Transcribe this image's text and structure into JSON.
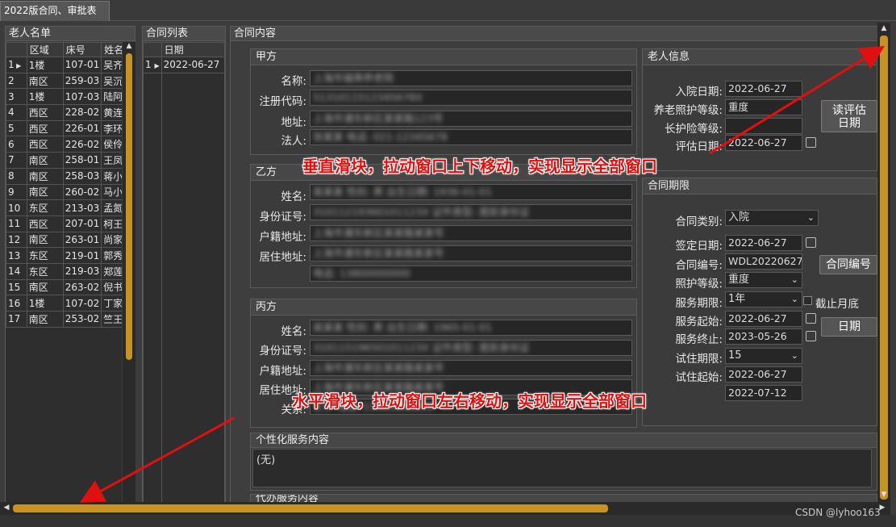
{
  "window": {
    "tab_label": "2022版合同、审批表"
  },
  "elders": {
    "title": "老人名单",
    "columns": [
      "区域",
      "床号",
      "姓名"
    ],
    "rows": [
      {
        "n": "1",
        "area": "1楼",
        "bed": "107-01",
        "name": "吴齐"
      },
      {
        "n": "2",
        "area": "南区",
        "bed": "259-03",
        "name": "吴沉"
      },
      {
        "n": "3",
        "area": "1楼",
        "bed": "107-03",
        "name": "陆阿"
      },
      {
        "n": "4",
        "area": "西区",
        "bed": "228-02",
        "name": "黄连"
      },
      {
        "n": "5",
        "area": "西区",
        "bed": "226-01",
        "name": "李环"
      },
      {
        "n": "6",
        "area": "西区",
        "bed": "226-02",
        "name": "侯伶"
      },
      {
        "n": "7",
        "area": "南区",
        "bed": "258-01",
        "name": "王凤"
      },
      {
        "n": "8",
        "area": "南区",
        "bed": "258-03",
        "name": "蒋小"
      },
      {
        "n": "9",
        "area": "南区",
        "bed": "260-02",
        "name": "马小"
      },
      {
        "n": "10",
        "area": "东区",
        "bed": "213-03",
        "name": "孟氮"
      },
      {
        "n": "11",
        "area": "西区",
        "bed": "207-01",
        "name": "柯王"
      },
      {
        "n": "12",
        "area": "南区",
        "bed": "263-01",
        "name": "尚家"
      },
      {
        "n": "13",
        "area": "东区",
        "bed": "219-01",
        "name": "郭秀"
      },
      {
        "n": "14",
        "area": "东区",
        "bed": "219-03",
        "name": "郑莲"
      },
      {
        "n": "15",
        "area": "南区",
        "bed": "263-02",
        "name": "倪书"
      },
      {
        "n": "16",
        "area": "1楼",
        "bed": "107-02",
        "name": "丁家"
      },
      {
        "n": "17",
        "area": "南区",
        "bed": "253-02",
        "name": "竺王"
      }
    ]
  },
  "contracts": {
    "title": "合同列表",
    "column": "日期",
    "rows": [
      {
        "n": "1",
        "date": "2022-06-27"
      }
    ]
  },
  "content": {
    "title": "合同内容",
    "party_a": {
      "title": "甲方",
      "name_label": "名称:",
      "code_label": "注册代码:",
      "address_label": "地址:",
      "legal_label": "法人:",
      "name_value": "上海市福寿养老院",
      "code_value": "5131011512345678X",
      "address_value": "上海市浦东新区某某路123号",
      "legal_value": "张某某  电话: 021-12345678"
    },
    "party_b": {
      "title": "乙方",
      "name_label": "姓名:",
      "id_label": "身份证号:",
      "hukou_label": "户籍地址:",
      "residence_label": "居住地址:",
      "name_value": "吴某某   性别: 男   出生日期: 1936-01-01",
      "id_value": "31011219360101123X   证件类型: 居民身份证",
      "hukou_value": "上海市浦东新区某某路某某号",
      "residence_value": "上海市浦东新区某某路某某号",
      "phone_value": "电话: 13800000000"
    },
    "party_c": {
      "title": "丙方",
      "name_label": "姓名:",
      "id_label": "身份证号:",
      "hukou_label": "户籍地址:",
      "residence_label": "居住地址:",
      "relation_label": "关系:",
      "name_value": "吴某某   性别: 男   出生日期: 1965-01-01",
      "id_value": "31011519650101123X   证件类型: 居民身份证",
      "hukou_value": "上海市浦东新区某某路某某号",
      "residence_value": "上海市浦东新区某某路某某号",
      "relation_value": "父子   电话: 13900000000"
    },
    "elder_info": {
      "title": "老人信息",
      "admit_label": "入院日期:",
      "admit_value": "2022-06-27",
      "care_label": "养老照护等级:",
      "care_value": "重度",
      "ltc_label": "长护险等级:",
      "ltc_value": "",
      "eval_label": "评估日期:",
      "eval_value": "2022-06-27",
      "read_btn": "读评估\n日期"
    },
    "term": {
      "title": "合同期限",
      "type_label": "合同类别:",
      "type_value": "入院",
      "sign_label": "签定日期:",
      "sign_value": "2022-06-27",
      "no_label": "合同编号:",
      "no_value": "WDL20220627",
      "no_btn": "合同编号",
      "care_label": "照护等级:",
      "care_value": "重度",
      "period_label": "服务期限:",
      "period_value": "1年",
      "month_end_label": "截止月底",
      "start_label": "服务起始:",
      "start_value": "2022-06-27",
      "end_label": "服务终止:",
      "end_value": "2023-05-26",
      "date_btn": "日期",
      "trial_label": "试住期限:",
      "trial_value": "15",
      "trial_start_label": "试住起始:",
      "trial_start_value": "2022-06-27",
      "trial_end_value": "2022-07-12"
    },
    "custom": {
      "title": "个性化服务内容",
      "value": "(无)"
    },
    "proxy": {
      "title": "代办服务内容"
    }
  },
  "annotations": {
    "vertical": "垂直滑块，拉动窗口上下移动，实现显示全部窗口",
    "horizontal": "水平滑块，拉动窗口左右移动，实现显示全部窗口"
  },
  "watermark": "CSDN @lyhoo163",
  "colors": {
    "accent": "#c79322",
    "annotation": "#e01010"
  }
}
